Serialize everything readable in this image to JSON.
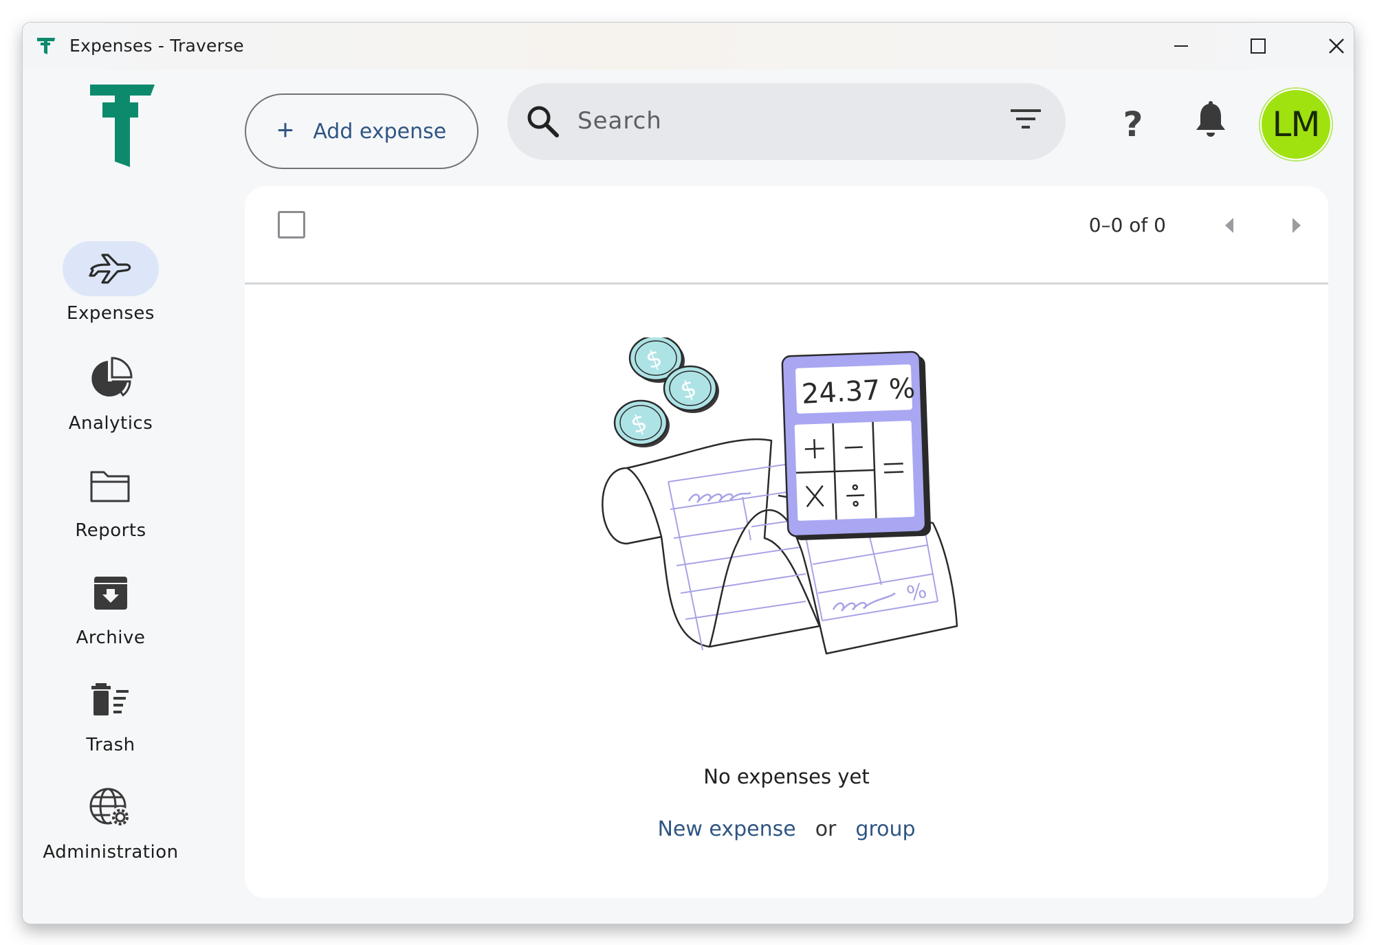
{
  "window": {
    "title": "Expenses - Traverse"
  },
  "sidebar": {
    "items": [
      {
        "label": "Expenses",
        "icon": "airplane-icon",
        "active": true
      },
      {
        "label": "Analytics",
        "icon": "pie-chart-icon",
        "active": false
      },
      {
        "label": "Reports",
        "icon": "folder-icon",
        "active": false
      },
      {
        "label": "Archive",
        "icon": "archive-box-icon",
        "active": false
      },
      {
        "label": "Trash",
        "icon": "trash-icon",
        "active": false
      },
      {
        "label": "Administration",
        "icon": "globe-gear-icon",
        "active": false
      }
    ]
  },
  "toolbar": {
    "add_expense_label": "Add expense",
    "search_placeholder": "Search",
    "avatar_initials": "LM",
    "help_glyph": "?"
  },
  "list": {
    "pagination_text": "0–0 of 0"
  },
  "empty_state": {
    "message": "No expenses yet",
    "new_expense_link": "New expense",
    "or_text": "or",
    "group_link": "group",
    "calculator_display": "24.37 %"
  },
  "colors": {
    "brand": "#0d8a6c",
    "link": "#2f5583",
    "active_nav_bg": "#dce6f8",
    "avatar_bg": "#9fe20f",
    "calculator": "#a9a7f2"
  }
}
